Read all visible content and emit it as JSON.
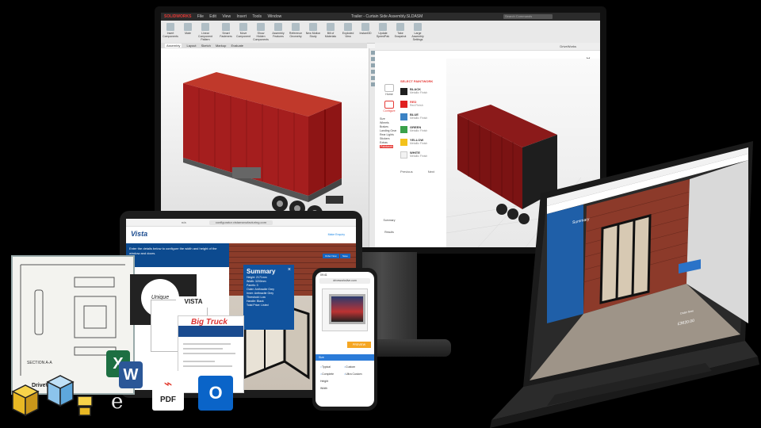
{
  "monitor": {
    "app_title": "SOLIDWORKS",
    "menu": [
      "File",
      "Edit",
      "View",
      "Insert",
      "Tools",
      "Window"
    ],
    "doc_title": "Trailer - Curtain Side Assembly.SLDASM",
    "search_placeholder": "Search Commands",
    "ribbon_tools": [
      "Insert Components",
      "Mate",
      "Linear Component Pattern",
      "Smart Fasteners",
      "Move Component",
      "Show Hidden Components",
      "Assembly Features",
      "Reference Geometry",
      "New Motion Study",
      "Bill of Materials",
      "Exploded View",
      "Instant3D",
      "Update SpeedPak",
      "Take Snapshot",
      "Large Assembly Settings"
    ],
    "tabs": [
      "Assembly",
      "Layout",
      "Sketch",
      "Markup",
      "Evaluate"
    ],
    "active_tab": "Assembly",
    "panel_title": "DriveWorks",
    "close_label": "×",
    "nav": {
      "home_label": "Home",
      "configure_label": "Configure",
      "list": [
        "Size",
        "Wheels",
        "Brakes",
        "Landing Gear",
        "Rear Lights",
        "Stickers",
        "Extras",
        "Paintwork"
      ],
      "selected": "Paintwork",
      "summary_label": "Summary",
      "results_label": "Results"
    },
    "paint_header": "SELECT PAINTWORK",
    "paint_options": [
      {
        "name": "BLACK",
        "sub": "Metallic Finish",
        "color": "#1f1f1f"
      },
      {
        "name": "RED",
        "sub": "Red Finish",
        "color": "#e02020"
      },
      {
        "name": "BLUE",
        "sub": "Metallic Finish",
        "color": "#3b82c4"
      },
      {
        "name": "GREEN",
        "sub": "Metallic Finish",
        "color": "#3aa14a"
      },
      {
        "name": "YELLOW",
        "sub": "Metallic Finish",
        "color": "#f3c21c"
      },
      {
        "name": "WHITE",
        "sub": "Metallic Finish",
        "color": "#f2f2f2"
      }
    ],
    "actions": [
      "Previous",
      "Next"
    ]
  },
  "tablet": {
    "tab_label": "n/a",
    "url": "configurator.vistamanufacturing.com",
    "logo": "Vista",
    "contact": "Make Enquiry",
    "hero_text": "Enter the details below to configure the width and height of the window and doors.",
    "summary_title": "Summary",
    "summary_close": "×",
    "summary_lines": [
      "Height: 2171mm",
      "Width: 3200mm",
      "Panels: 3",
      "Outer: Anthracite Grey",
      "Inner: Anthracite Grey",
      "Threshold: Low",
      "Handle: Black",
      "Total Price: Listed"
    ],
    "btn_a": "Order Now",
    "btn_b": "Save"
  },
  "phone": {
    "time": "09:41",
    "url": "driveworkslive.com",
    "price": "PREVIEW",
    "bar_label": "Size",
    "options": [
      "Typical",
      "Custom",
      "Complete",
      "Ultra Custom"
    ],
    "dims": [
      "Height",
      "Width"
    ]
  },
  "docs": {
    "drawing_label": "SECTION A-A",
    "drawing_logo": "DriveWorks",
    "dark_logo": "Unique",
    "vistameo": "VISTA",
    "bigtruck": "Big Truck"
  },
  "office": {
    "excel": "X",
    "word": "W",
    "pdf": "PDF",
    "pdf_symbol": "⌁",
    "outlook": "O",
    "e_logo": "e"
  },
  "laptop": {
    "title": "Summary",
    "price": "£3620.00",
    "order_btn": "Order Now"
  }
}
